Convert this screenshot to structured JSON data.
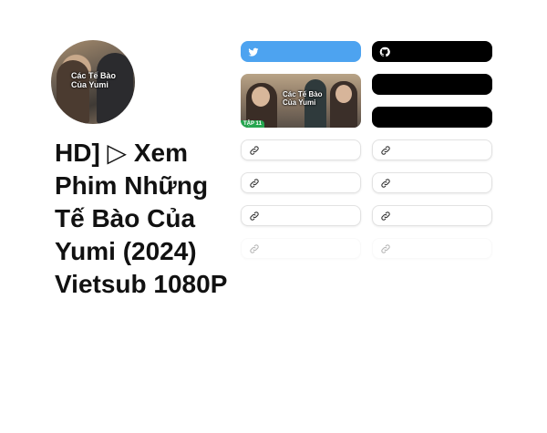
{
  "profile": {
    "avatar_overlay_text": "Các Tế Bào Của Yumi",
    "title": "HD] ▷ Xem Phim Những Tế Bào Của Yumi (2024) Vietsub 1080P"
  },
  "buttons": [
    {
      "id": "twitter",
      "icon": "twitter-bird-icon",
      "color": "#4da3f0"
    },
    {
      "id": "github",
      "icon": "github-icon",
      "color": "#000000"
    },
    {
      "id": "black-1",
      "color": "#000000"
    },
    {
      "id": "black-2",
      "color": "#000000"
    }
  ],
  "media_card": {
    "overlay_text": "Các Tế Bào Của Yumi",
    "badge": "TẬP 11"
  },
  "links": [
    {
      "icon": "link-icon"
    },
    {
      "icon": "link-icon"
    },
    {
      "icon": "link-icon"
    },
    {
      "icon": "link-icon"
    },
    {
      "icon": "link-icon"
    },
    {
      "icon": "link-icon"
    },
    {
      "icon": "link-icon"
    },
    {
      "icon": "link-icon"
    }
  ]
}
